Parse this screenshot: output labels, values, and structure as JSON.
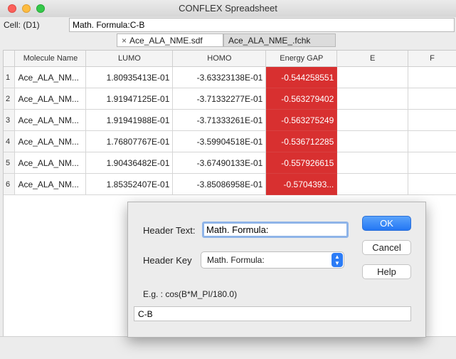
{
  "window": {
    "title": "CONFLEX Spreadsheet"
  },
  "cellbar": {
    "label": "Cell: (D1)",
    "value": "Math. Formula:C-B"
  },
  "tabs": [
    {
      "label": "Ace_ALA_NME.sdf",
      "close_icon": "×",
      "active": true
    },
    {
      "label": "Ace_ALA_NME_.fchk",
      "active": false
    }
  ],
  "table": {
    "columns": [
      "Molecule Name",
      "LUMO",
      "HOMO",
      "Energy GAP",
      "E",
      "F"
    ],
    "rows": [
      {
        "index": "1",
        "name": "Ace_ALA_NM...",
        "lumo": "1.80935413E-01",
        "homo": "-3.63323138E-01",
        "gap": "-0.544258551"
      },
      {
        "index": "2",
        "name": "Ace_ALA_NM...",
        "lumo": "1.91947125E-01",
        "homo": "-3.71332277E-01",
        "gap": "-0.563279402"
      },
      {
        "index": "3",
        "name": "Ace_ALA_NM...",
        "lumo": "1.91941988E-01",
        "homo": "-3.71333261E-01",
        "gap": "-0.563275249"
      },
      {
        "index": "4",
        "name": "Ace_ALA_NM...",
        "lumo": "1.76807767E-01",
        "homo": "-3.59904518E-01",
        "gap": "-0.536712285"
      },
      {
        "index": "5",
        "name": "Ace_ALA_NM...",
        "lumo": "1.90436482E-01",
        "homo": "-3.67490133E-01",
        "gap": "-0.557926615"
      },
      {
        "index": "6",
        "name": "Ace_ALA_NM...",
        "lumo": "1.85352407E-01",
        "homo": "-3.85086958E-01",
        "gap": "-0.5704393..."
      }
    ],
    "highlight_color": "#d83030"
  },
  "dialog": {
    "header_text_label": "Header Text:",
    "header_text_value": "Math. Formula:",
    "header_key_label": "Header Key",
    "header_key_value": "Math. Formula:",
    "example_label": "E.g. : cos(B*M_PI/180.0)",
    "expression_value": "C-B",
    "ok_label": "OK",
    "cancel_label": "Cancel",
    "help_label": "Help",
    "accent_color": "#2c7cf6"
  }
}
